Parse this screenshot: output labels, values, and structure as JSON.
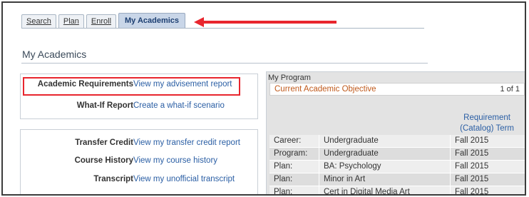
{
  "tabs": [
    {
      "label": "Search"
    },
    {
      "label": "Plan"
    },
    {
      "label": "Enroll"
    },
    {
      "label": "My Academics"
    }
  ],
  "colors": {
    "highlight": "#e8262e",
    "link": "#2a5ea4",
    "objective_title": "#c05a1c"
  },
  "page_title": "My Academics",
  "requirements": [
    {
      "label": "Academic Requirements",
      "link": "View my advisement report"
    },
    {
      "label": "What-If Report",
      "link": "Create a what-if scenario"
    }
  ],
  "records": [
    {
      "label": "Transfer Credit",
      "link": "View my transfer credit report"
    },
    {
      "label": "Course History",
      "link": "View my course history"
    },
    {
      "label": "Transcript",
      "link": "View my unofficial transcript"
    }
  ],
  "program": {
    "label": "My Program",
    "objective_title": "Current Academic Objective",
    "page_count": "1 of 1",
    "requirement_header_line1": "Requirement",
    "requirement_header_line2": "(Catalog) Term",
    "rows": [
      {
        "type": "Career:",
        "value": "Undergraduate",
        "term": "Fall 2015"
      },
      {
        "type": "Program:",
        "value": "Undergraduate",
        "term": "Fall 2015"
      },
      {
        "type": "Plan:",
        "value": "BA: Psychology",
        "term": "Fall 2015"
      },
      {
        "type": "Plan:",
        "value": "Minor in Art",
        "term": "Fall 2015"
      },
      {
        "type": "Plan:",
        "value": "Cert in Digital Media Art",
        "term": "Fall 2015"
      }
    ]
  }
}
